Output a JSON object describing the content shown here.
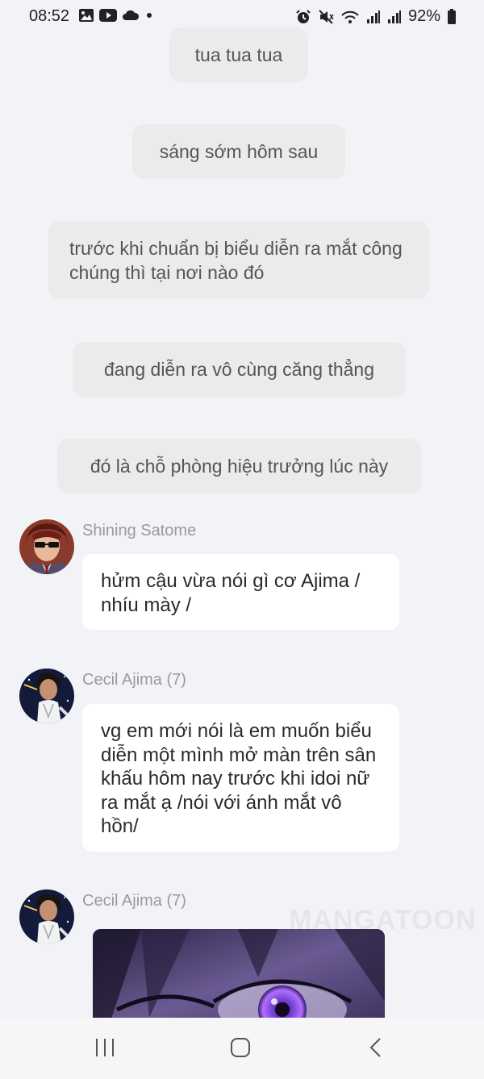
{
  "status_bar": {
    "time": "08:52",
    "battery": "92%",
    "left_icons": [
      "image-icon",
      "youtube-icon",
      "cloud-icon",
      "dot-icon"
    ],
    "right_icons": [
      "alarm-icon",
      "mute-icon",
      "wifi-icon",
      "signal-icon",
      "signal-icon",
      "battery-icon"
    ]
  },
  "narrations": [
    "tua tua tua",
    "sáng sớm hôm sau",
    "trước khi chuẩn bị biểu diễn ra mắt công chúng thì tại nơi nào đó",
    "đang diễn ra vô cùng căng thẳng",
    "đó là chỗ phòng hiệu trưởng lúc này"
  ],
  "messages": [
    {
      "name": "Shining Satome",
      "text": "hửm cậu vừa nói gì cơ Ajima / nhíu mày /"
    },
    {
      "name": "Cecil Ajima (7)",
      "text": "vg em mới nói là em muốn biểu diễn một mình mở màn trên sân khấu hôm nay trước khi idoi nữ ra mắt ạ /nói với ánh mắt vô hồn/"
    },
    {
      "name": "Cecil Ajima (7)",
      "text": ""
    }
  ],
  "watermark": "MANGATOON",
  "nav": [
    "recent-apps-icon",
    "home-icon",
    "back-icon"
  ]
}
